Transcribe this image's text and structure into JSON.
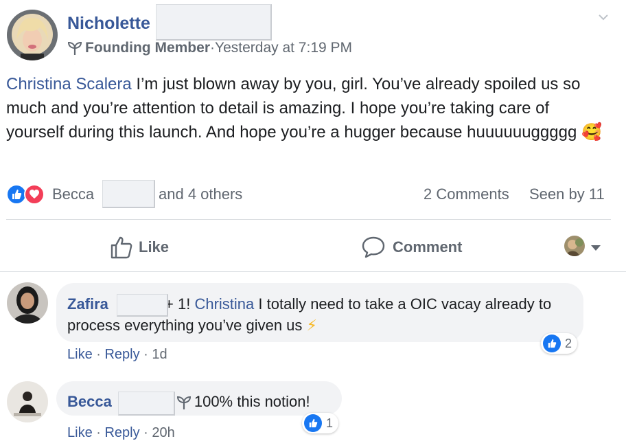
{
  "post": {
    "author_name": "Nicholette",
    "badge": "Founding Member",
    "separator": " · ",
    "timestamp": "Yesterday at 7:19 PM",
    "mention": "Christina Scalera",
    "body": " I’m just blown away by you, girl. You’ve already spoiled us so much and you’re attention to detail is amazing. I hope you’re taking care of yourself during this launch. And hope you’re a hugger because huuuuuuggggg",
    "emoji": "🥰"
  },
  "reactions": {
    "first_name": "Becca",
    "others": "and 4 others",
    "comments_count": "2 Comments",
    "seen_by": "Seen by 11"
  },
  "actions": {
    "like": "Like",
    "comment": "Comment"
  },
  "comments": [
    {
      "author": "Zafira",
      "prefix": " + 1! ",
      "mention": "Christina",
      "text": " I totally need to take a OIC vacay already to process everything you’ve given us",
      "emoji": "⚡",
      "like": "Like",
      "reply": "Reply",
      "dot": " · ",
      "age": "1d",
      "like_count": "2"
    },
    {
      "author": "Becca",
      "text": "100% this notion!",
      "like": "Like",
      "reply": "Reply",
      "dot": " · ",
      "age": "20h",
      "like_count": "1"
    }
  ],
  "colors": {
    "link": "#385898",
    "like_blue": "#1877f2",
    "love_red": "#f33e58",
    "bubble_bg": "#f2f3f5"
  }
}
